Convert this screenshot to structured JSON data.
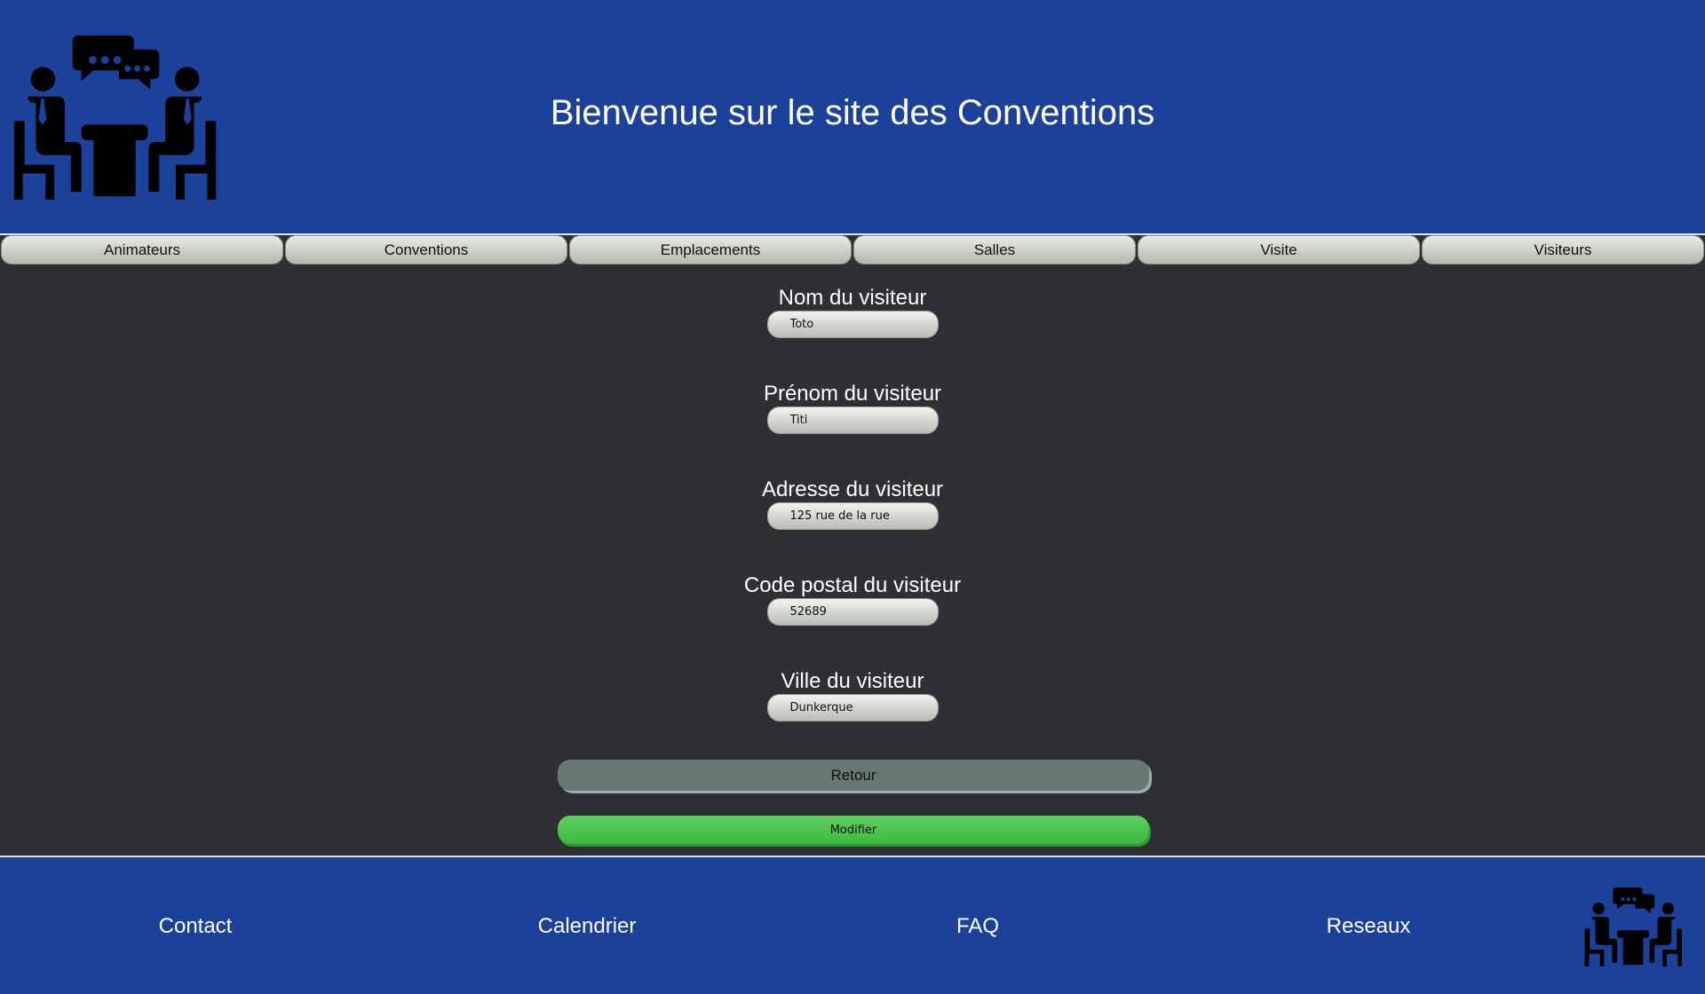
{
  "header": {
    "title": "Bienvenue sur le site des Conventions",
    "logo_icon": "meeting-people-icon"
  },
  "nav": {
    "items": [
      {
        "label": "Animateurs"
      },
      {
        "label": "Conventions"
      },
      {
        "label": "Emplacements"
      },
      {
        "label": "Salles"
      },
      {
        "label": "Visite"
      },
      {
        "label": "Visiteurs"
      }
    ]
  },
  "form": {
    "fields": [
      {
        "label": "Nom du visiteur",
        "value": "Toto"
      },
      {
        "label": "Prénom du visiteur",
        "value": "Titi"
      },
      {
        "label": "Adresse du visiteur",
        "value": "125 rue de la rue"
      },
      {
        "label": "Code postal du visiteur",
        "value": "52689"
      },
      {
        "label": "Ville du visiteur",
        "value": "Dunkerque"
      }
    ],
    "back_label": "Retour",
    "submit_label": "Modifier"
  },
  "footer": {
    "links": [
      {
        "label": "Contact"
      },
      {
        "label": "Calendrier"
      },
      {
        "label": "FAQ"
      },
      {
        "label": "Reseaux"
      }
    ],
    "logo_icon": "meeting-people-icon"
  },
  "colors": {
    "header_blue": "#1c419b",
    "body_dark": "#2f3034",
    "submit_green": "#4cc44c",
    "back_gray": "#677774"
  }
}
